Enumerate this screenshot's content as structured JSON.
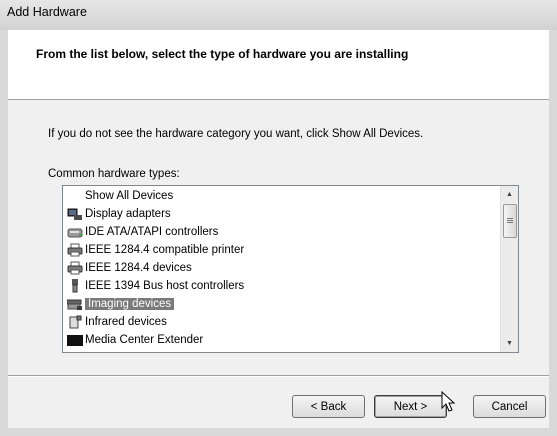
{
  "window": {
    "title": "Add Hardware"
  },
  "header": {
    "heading": "From the list below, select the type of hardware you are installing"
  },
  "body": {
    "instruction": "If you do not see the hardware category you want, click Show All Devices.",
    "list_label": "Common hardware types:"
  },
  "list": {
    "items": [
      {
        "label": "Show All Devices",
        "icon": "none"
      },
      {
        "label": "Display adapters",
        "icon": "display-adapter-icon"
      },
      {
        "label": "IDE ATA/ATAPI controllers",
        "icon": "ide-controller-icon"
      },
      {
        "label": "IEEE 1284.4 compatible printer",
        "icon": "printer-icon"
      },
      {
        "label": "IEEE 1284.4 devices",
        "icon": "printer-icon"
      },
      {
        "label": "IEEE 1394 Bus host controllers",
        "icon": "ieee1394-icon"
      },
      {
        "label": "Imaging devices",
        "icon": "scanner-icon",
        "selected": true
      },
      {
        "label": "Infrared devices",
        "icon": "infrared-icon"
      },
      {
        "label": "Media Center Extender",
        "icon": "media-center-icon"
      }
    ],
    "selected_index": 6
  },
  "buttons": {
    "back": "< Back",
    "next": "Next >",
    "cancel": "Cancel"
  },
  "colors": {
    "selection": "#7a7a7a",
    "window_bg": "#f0f0f0",
    "header_bg": "#ffffff"
  }
}
